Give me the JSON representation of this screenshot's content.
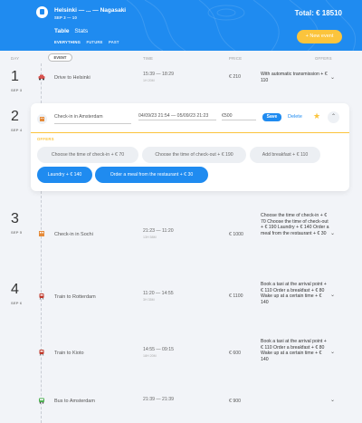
{
  "header": {
    "route": "Helsinki — ... — Nagasaki",
    "dates": "SEP 3 — 10",
    "total": "Total: € 18510",
    "view_tabs": [
      "Table",
      "Stats"
    ],
    "filter_tabs": [
      "EVERYTHING",
      "FUTURE",
      "PAST"
    ],
    "new_event_label": "+ New event",
    "colors": {
      "brand": "#1f8bf0",
      "accent": "#fbc43c"
    }
  },
  "columns": {
    "day": "DAY",
    "event": "EVENT",
    "time": "TIME",
    "price": "PRICE",
    "offers": "OFFERS"
  },
  "days": [
    {
      "num": "1",
      "date": "SEP 3"
    },
    {
      "num": "2",
      "date": "SEP 4"
    },
    {
      "num": "3",
      "date": "SEP 5"
    },
    {
      "num": "4",
      "date": "SEP 6"
    }
  ],
  "events": [
    {
      "icon": "car-icon",
      "title": "Drive to Helsinki",
      "time": "15:39 — 18:29",
      "duration": "1H 20M",
      "price": "€ 210",
      "offers": "With automatic transmission + € 110"
    },
    {
      "icon": "hotel-icon",
      "title": "Check-in in Sochi",
      "time": "21:23 — 11:20",
      "duration": "13H 58M",
      "price": "€ 1000",
      "offers": "Choose the time of check-in + € 70 Choose the time of check-out + € 190 Laundry + € 140 Order a meal from the restaurant + € 30"
    },
    {
      "icon": "train-icon",
      "title": "Train to Rotterdam",
      "time": "11:20 — 14:55",
      "duration": "3H 35M",
      "price": "€ 1100",
      "offers": "Book a taxi at the arrival point + € 110 Order a breakfast + € 80 Wake up at a certain time + € 140"
    },
    {
      "icon": "train-icon",
      "title": "Train to Kioto",
      "time": "14:55 — 09:15",
      "duration": "18H 20M",
      "price": "€ 600",
      "offers": "Book a taxi at the arrival point + € 110 Order a breakfast + € 80 Wake up at a certain time + € 140"
    },
    {
      "icon": "bus-icon",
      "title": "Bus to Amsterdam",
      "time": "21:39 — 21:39",
      "duration": "",
      "price": "€ 900",
      "offers": ""
    }
  ],
  "edit_form": {
    "icon": "hotel-icon",
    "destination": "Check-in in Amsterdam",
    "dates": "04/09/23 21:54 — 05/09/23 21:23",
    "price": "€500",
    "save_label": "Save",
    "delete_label": "Delete",
    "offers_label": "OFFERS",
    "offers": [
      {
        "label": "Choose the time of check-in + € 70",
        "selected": false
      },
      {
        "label": "Choose the time of check-out + € 190",
        "selected": false
      },
      {
        "label": "Add breakfast + € 110",
        "selected": false
      },
      {
        "label": "Laundry + € 140",
        "selected": true
      },
      {
        "label": "Order a meal from the restaurant + € 30",
        "selected": true
      }
    ]
  }
}
